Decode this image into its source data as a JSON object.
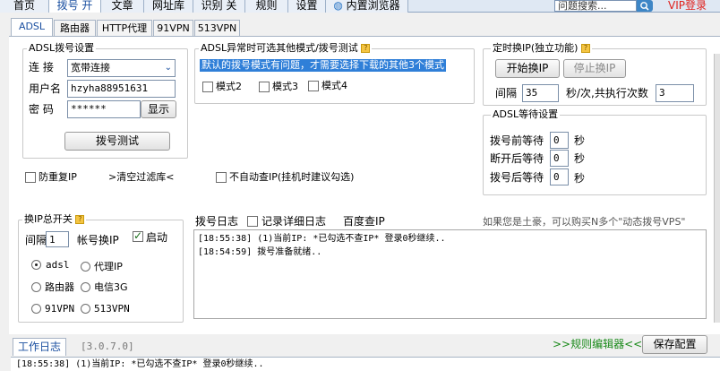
{
  "top_tabs": [
    "首页",
    "拨号 开",
    "文章",
    "网址库",
    "识别 关",
    "规则",
    "设置",
    "内置浏览器"
  ],
  "search": {
    "value": "问题搜索..."
  },
  "vip_label": "VIP登录",
  "sub_tabs": [
    "ADSL",
    "路由器",
    "HTTP代理",
    "91VPN",
    "513VPN"
  ],
  "adsl_dial": {
    "title": "ADSL拨号设置",
    "connect_label": "连 接",
    "connect_value": "宽带连接",
    "user_label": "用户名",
    "user_value": "hzyha88951631",
    "pass_label": "密 码",
    "pass_value": "******",
    "show_button": "显示",
    "test_button": "拨号测试"
  },
  "adsl_abnormal": {
    "title": "ADSL异常时可选其他模式/拨号测试",
    "notice": "默认的拨号模式有问题，才需要选择下载的其他3个模式",
    "mode2": "模式2",
    "mode3": "模式3",
    "mode4": "模式4"
  },
  "timer": {
    "title": "定时换IP(独立功能)",
    "start_button": "开始换IP",
    "stop_button": "停止换IP",
    "interval_label": "间隔",
    "interval_value": "35",
    "unit_label": "秒/次,共执行次数",
    "count_value": "3"
  },
  "wait": {
    "title": "ADSL等待设置",
    "before_label": "拨号前等待",
    "before_value": "0",
    "disconnect_label": "断开后等待",
    "disconnect_value": "0",
    "after_label": "拨号后等待",
    "after_value": "0",
    "sec": "秒"
  },
  "options": {
    "dup_ip": "防重复IP",
    "clear_filter": ">清空过滤库<",
    "no_auto_check": "不自动查IP(挂机时建议勾选)"
  },
  "switch": {
    "title": "换IP总开关",
    "interval_label": "间隔",
    "interval_value": "1",
    "account_label": "帐号换IP",
    "enable_label": "启动",
    "radios": [
      "adsl",
      "代理IP",
      "路由器",
      "电信3G",
      "91VPN",
      "513VPN"
    ]
  },
  "dial_log": {
    "title": "拨号日志",
    "detail_label": "记录详细日志",
    "baidu_label": "百度查IP",
    "promo": "如果您是土豪，可以购买N多个\"动态拨号VPS\"",
    "lines": [
      "[18:55:38] (1)当前IP: *已勾选不查IP* 登录0秒继续..",
      "[18:54:59] 拨号准备就绪.."
    ]
  },
  "bottom": {
    "work_log_tab": "工作日志",
    "version": "[3.0.7.0]",
    "rule_editor": ">>规则编辑器<<",
    "save_button": "保存配置",
    "log_line": "[18:55:38] (1)当前IP: *已勾选不查IP* 登录0秒继续.."
  },
  "colors": {
    "accent": "#1a4fa0",
    "vip": "#e0201c",
    "link_green": "#1a8a1a",
    "notice_bg": "#2f7fd8"
  }
}
